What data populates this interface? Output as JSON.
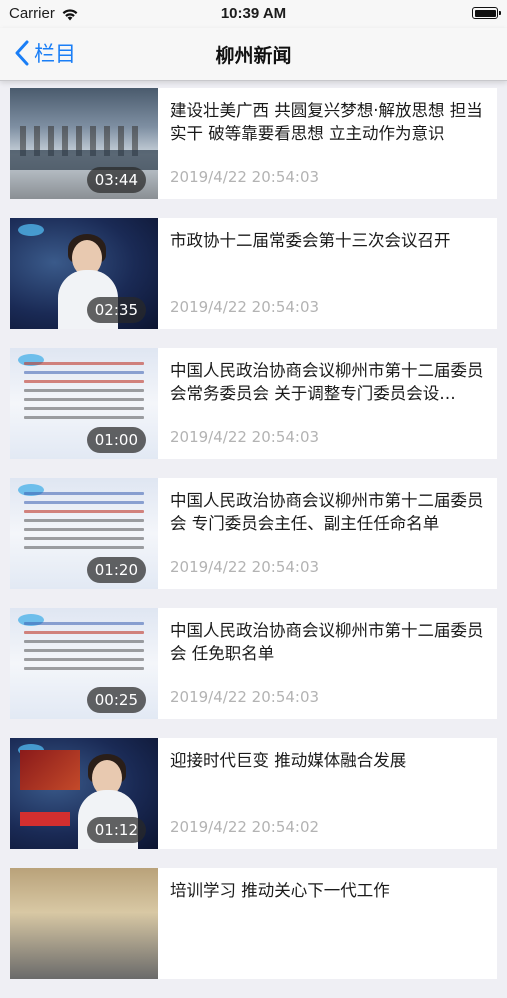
{
  "status_bar": {
    "carrier": "Carrier",
    "time": "10:39 AM"
  },
  "nav": {
    "back_label": "栏目",
    "title": "柳州新闻"
  },
  "news": [
    {
      "title": "建设壮美广西 共圆复兴梦想·解放思想 担当实干 破等靠要看思想 立主动作为意识",
      "time": "2019/4/22 20:54:03",
      "duration": "03:44",
      "scene": "station"
    },
    {
      "title": "市政协十二届常委会第十三次会议召开",
      "time": "2019/4/22 20:54:03",
      "duration": "02:35",
      "scene": "anchor"
    },
    {
      "title": "中国人民政治协商会议柳州市第十二届委员会常务委员会 关于调整专门委员会设…",
      "time": "2019/4/22 20:54:03",
      "duration": "01:00",
      "scene": "doc"
    },
    {
      "title": "中国人民政治协商会议柳州市第十二届委员会 专门委员会主任、副主任任命名单",
      "time": "2019/4/22 20:54:03",
      "duration": "01:20",
      "scene": "doc"
    },
    {
      "title": "中国人民政治协商会议柳州市第十二届委员会 任免职名单",
      "time": "2019/4/22 20:54:03",
      "duration": "00:25",
      "scene": "doc"
    },
    {
      "title": "迎接时代巨变 推动媒体融合发展",
      "time": "2019/4/22 20:54:02",
      "duration": "01:12",
      "scene": "anchor2"
    },
    {
      "title": "培训学习 推动关心下一代工作",
      "time": "",
      "duration": "",
      "scene": "crowd"
    }
  ]
}
